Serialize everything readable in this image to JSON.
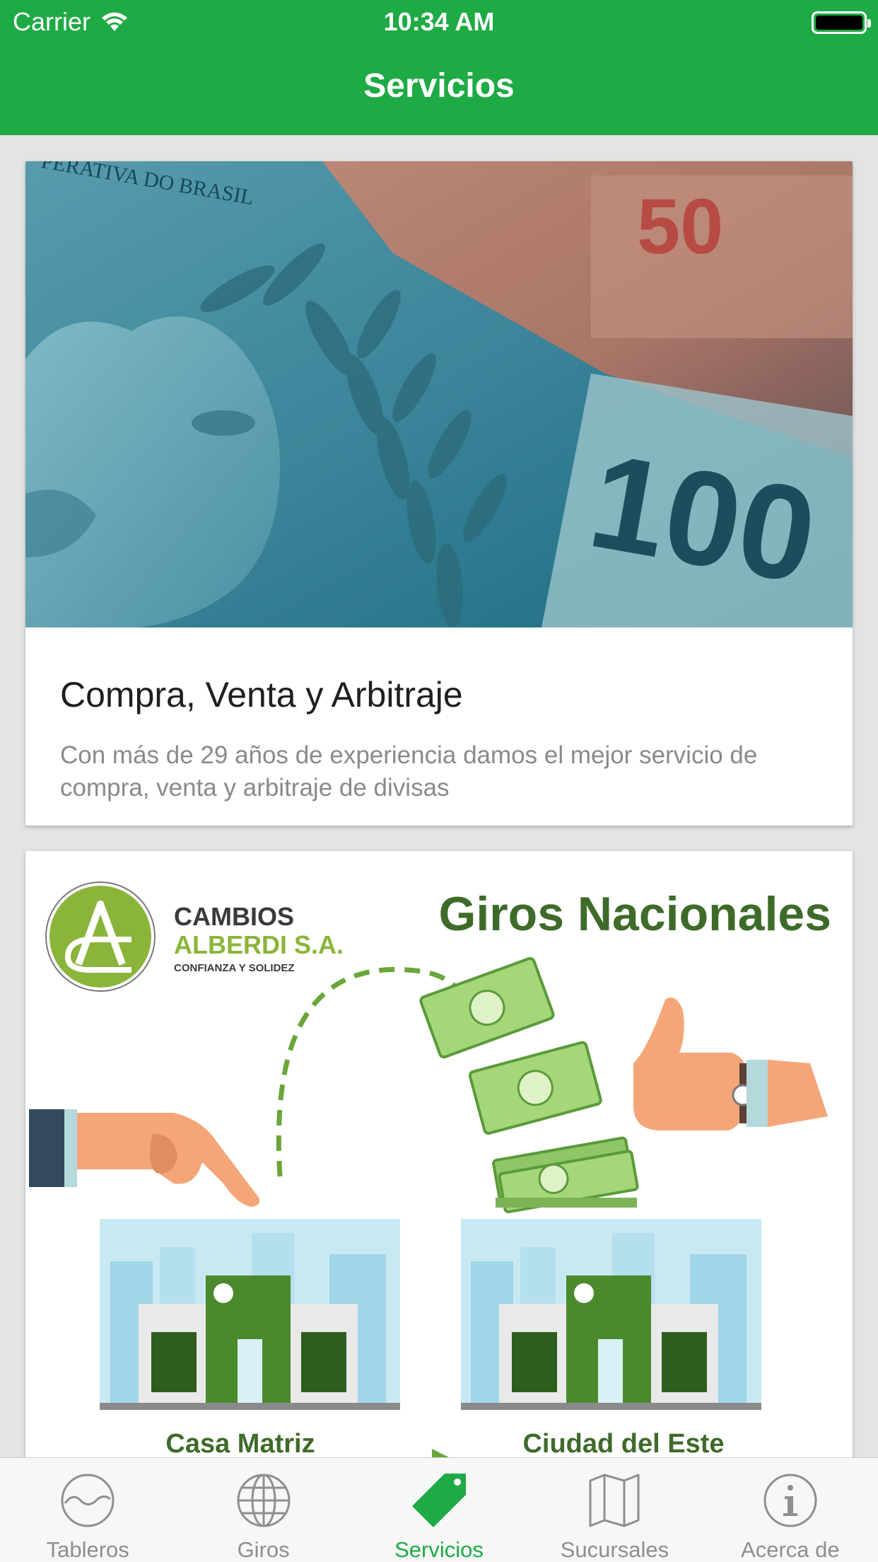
{
  "status_bar": {
    "carrier": "Carrier",
    "time": "10:34 AM"
  },
  "nav": {
    "title": "Servicios"
  },
  "cards": [
    {
      "title": "Compra, Venta y Arbitraje",
      "description": "Con más de 29 años de experiencia damos el mejor servicio de compra, venta y arbitraje de divisas",
      "image": {
        "banknote_text": "PERATIVA DO BRASIL",
        "denomination_top": "50",
        "denomination_main": "100"
      }
    },
    {
      "image": {
        "brand_line1": "CAMBIOS",
        "brand_line2": "ALBERDI S.A.",
        "brand_tagline": "CONFIANZA Y SOLIDEZ",
        "heading": "Giros Nacionales",
        "building_left_label": "Casa Matriz",
        "building_right_label": "Ciudad del Este"
      }
    }
  ],
  "tabbar": {
    "items": [
      {
        "label": "Tableros",
        "icon": "wave-circle-icon",
        "active": false
      },
      {
        "label": "Giros",
        "icon": "globe-icon",
        "active": false
      },
      {
        "label": "Servicios",
        "icon": "tag-icon",
        "active": true
      },
      {
        "label": "Sucursales",
        "icon": "map-icon",
        "active": false
      },
      {
        "label": "Acerca de",
        "icon": "info-icon",
        "active": false
      }
    ]
  },
  "colors": {
    "primary_green": "#1eaa44",
    "brand_green": "#7cb342",
    "heading_green": "#3f6b2a",
    "inactive_gray": "#8e8e93"
  }
}
